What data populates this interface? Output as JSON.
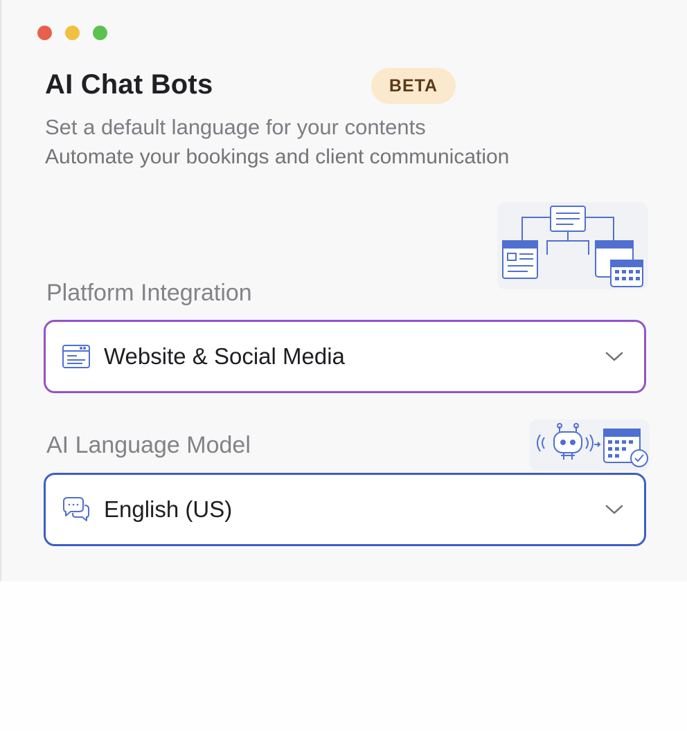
{
  "window": {
    "controls": [
      "close",
      "minimize",
      "zoom"
    ]
  },
  "header": {
    "title": "AI Chat Bots",
    "badge": "BETA",
    "subtitle_primary": "Set a default language for your contents",
    "subtitle_secondary": "Automate your bookings and client communication"
  },
  "platform": {
    "label": "Platform Integration",
    "selected": "Website & Social Media",
    "icon": "browser-window-icon",
    "illustration": "website-calendar-flow-illustration"
  },
  "model": {
    "label": "AI Language Model",
    "selected": "English (US)",
    "icon": "chat-bubbles-icon",
    "illustration": "robot-calendar-illustration"
  },
  "colors": {
    "platform_border": "#9552c9",
    "model_border": "#3d5fc4",
    "badge_bg": "#fbe9cd",
    "icon_blue": "#4f6fd1"
  }
}
